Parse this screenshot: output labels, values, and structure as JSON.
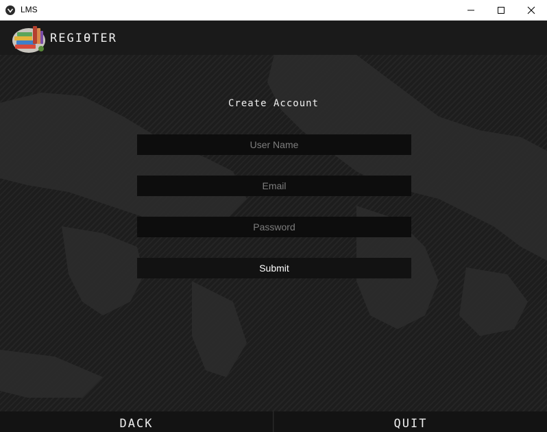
{
  "window": {
    "title": "LMS",
    "icon": "app-logo-icon",
    "controls": [
      "minimize-icon",
      "maximize-icon",
      "close-icon"
    ]
  },
  "header": {
    "logo": "books-logo",
    "title": "REGIƟTER"
  },
  "form": {
    "title": "Create Account",
    "username_placeholder": "User Name",
    "email_placeholder": "Email",
    "password_placeholder": "Password",
    "submit_label": "Submit"
  },
  "footer": {
    "back_label": "DACK",
    "quit_label": "QUIT"
  },
  "colors": {
    "background": "#1d1d1d",
    "field_bg": "#0d0d0d",
    "text": "#f0f0f0",
    "placeholder": "#7d7d7d"
  }
}
